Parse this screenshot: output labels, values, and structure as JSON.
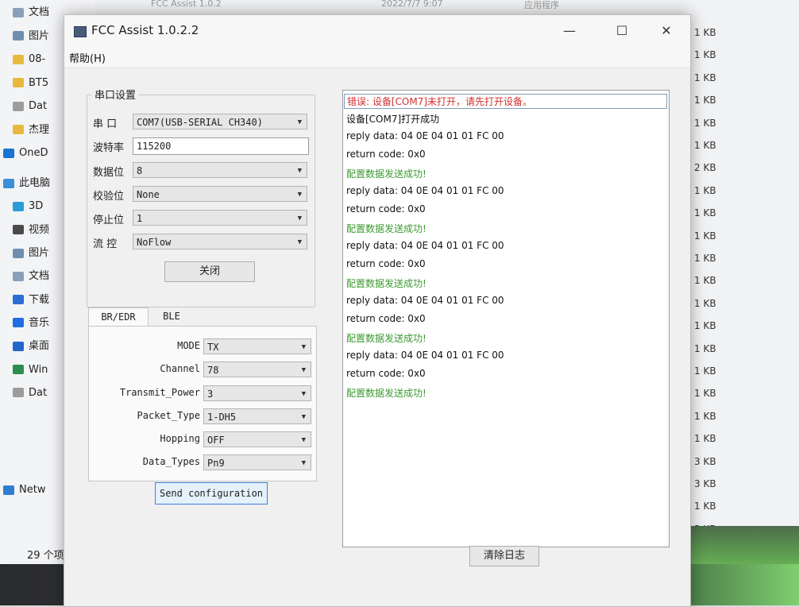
{
  "explorer": {
    "top_text": [
      "FCC Assist 1.0.2",
      "2022/7/7 9:07",
      "应用程序"
    ],
    "nav_items": [
      {
        "label": "文档",
        "icon": "document-icon",
        "color": "#8aa0b8"
      },
      {
        "label": "图片",
        "icon": "pictures-icon",
        "color": "#6f8fb0"
      },
      {
        "label": "08-",
        "icon": "folder-icon",
        "color": "#e8b93e"
      },
      {
        "label": "BT5",
        "icon": "folder-icon",
        "color": "#e8b93e"
      },
      {
        "label": "Dat",
        "icon": "drive-icon",
        "color": "#9c9c9c"
      },
      {
        "label": "杰理",
        "icon": "folder-icon",
        "color": "#e8b93e"
      },
      {
        "label": "OneD",
        "icon": "cloud-icon",
        "color": "#1b73d2"
      },
      {
        "label": "此电脑",
        "icon": "computer-icon",
        "color": "#3c8fd6"
      },
      {
        "label": "3D",
        "icon": "3d-objects-icon",
        "color": "#2d9bd8"
      },
      {
        "label": "视频",
        "icon": "video-icon",
        "color": "#4a4a4a"
      },
      {
        "label": "图片",
        "icon": "pictures-icon",
        "color": "#6f8fb0"
      },
      {
        "label": "文档",
        "icon": "document-icon",
        "color": "#8aa0b8"
      },
      {
        "label": "下载",
        "icon": "download-icon",
        "color": "#2a6fd2"
      },
      {
        "label": "音乐",
        "icon": "music-icon",
        "color": "#1f6fe0"
      },
      {
        "label": "桌面",
        "icon": "desktop-icon",
        "color": "#2266cc"
      },
      {
        "label": "Win",
        "icon": "windows-drive-icon",
        "color": "#2a8f4e"
      },
      {
        "label": "Dat",
        "icon": "drive-icon",
        "color": "#9c9c9c"
      },
      {
        "label": "Netw",
        "icon": "network-icon",
        "color": "#2f7fd1"
      }
    ],
    "item_count": "29 个项目",
    "file_sizes": [
      "1 KB",
      "1 KB",
      "1 KB",
      "1 KB",
      "1 KB",
      "1 KB",
      "2 KB",
      "1 KB",
      "1 KB",
      "1 KB",
      "1 KB",
      "1 KB",
      "1 KB",
      "1 KB",
      "1 KB",
      "1 KB",
      "1 KB",
      "1 KB",
      "1 KB",
      "3 KB",
      "3 KB",
      "1 KB",
      "3 KB"
    ]
  },
  "app": {
    "title": "FCC Assist 1.0.2.2",
    "window_buttons": {
      "minimize": "—",
      "maximize": "☐",
      "close": "✕"
    },
    "menu": {
      "help": "帮助(H)"
    },
    "serial": {
      "group_title": "串口设置",
      "port_label": "串 口",
      "port_value": "COM7(USB-SERIAL CH340)",
      "baud_label": "波特率",
      "baud_value": "115200",
      "databits_label": "数据位",
      "databits_value": "8",
      "parity_label": "校验位",
      "parity_value": "None",
      "stopbits_label": "停止位",
      "stopbits_value": "1",
      "flow_label": "流 控",
      "flow_value": "NoFlow",
      "close_button": "关闭"
    },
    "tabs": {
      "br_edr": "BR/EDR",
      "ble": "BLE"
    },
    "config": {
      "mode_label": "MODE",
      "mode_value": "TX",
      "channel_label": "Channel",
      "channel_value": "78",
      "power_label": "Transmit_Power",
      "power_value": "3",
      "packet_label": "Packet_Type",
      "packet_value": "1-DH5",
      "hopping_label": "Hopping",
      "hopping_value": "OFF",
      "datatypes_label": "Data_Types",
      "datatypes_value": "Pn9"
    },
    "send_button": "Send configuration",
    "log_lines": [
      {
        "text": "错误: 设备[COM7]未打开，请先打开设备。",
        "color": "#d22f2f"
      },
      {
        "text": "设备[COM7]打开成功",
        "color": "#111111"
      },
      {
        "text": "reply data: 04 0E 04 01 01 FC 00",
        "color": "#111111"
      },
      {
        "text": "return code: 0x0",
        "color": "#111111"
      },
      {
        "text": "配置数据发送成功!",
        "color": "#3a9a2e"
      },
      {
        "text": "reply data: 04 0E 04 01 01 FC 00",
        "color": "#111111"
      },
      {
        "text": "return code: 0x0",
        "color": "#111111"
      },
      {
        "text": "配置数据发送成功!",
        "color": "#3a9a2e"
      },
      {
        "text": "reply data: 04 0E 04 01 01 FC 00",
        "color": "#111111"
      },
      {
        "text": "return code: 0x0",
        "color": "#111111"
      },
      {
        "text": "配置数据发送成功!",
        "color": "#3a9a2e"
      },
      {
        "text": "reply data: 04 0E 04 01 01 FC 00",
        "color": "#111111"
      },
      {
        "text": "return code: 0x0",
        "color": "#111111"
      },
      {
        "text": "配置数据发送成功!",
        "color": "#3a9a2e"
      },
      {
        "text": "reply data: 04 0E 04 01 01 FC 00",
        "color": "#111111"
      },
      {
        "text": "return code: 0x0",
        "color": "#111111"
      },
      {
        "text": "配置数据发送成功!",
        "color": "#3a9a2e"
      }
    ],
    "clear_log_button": "清除日志"
  }
}
